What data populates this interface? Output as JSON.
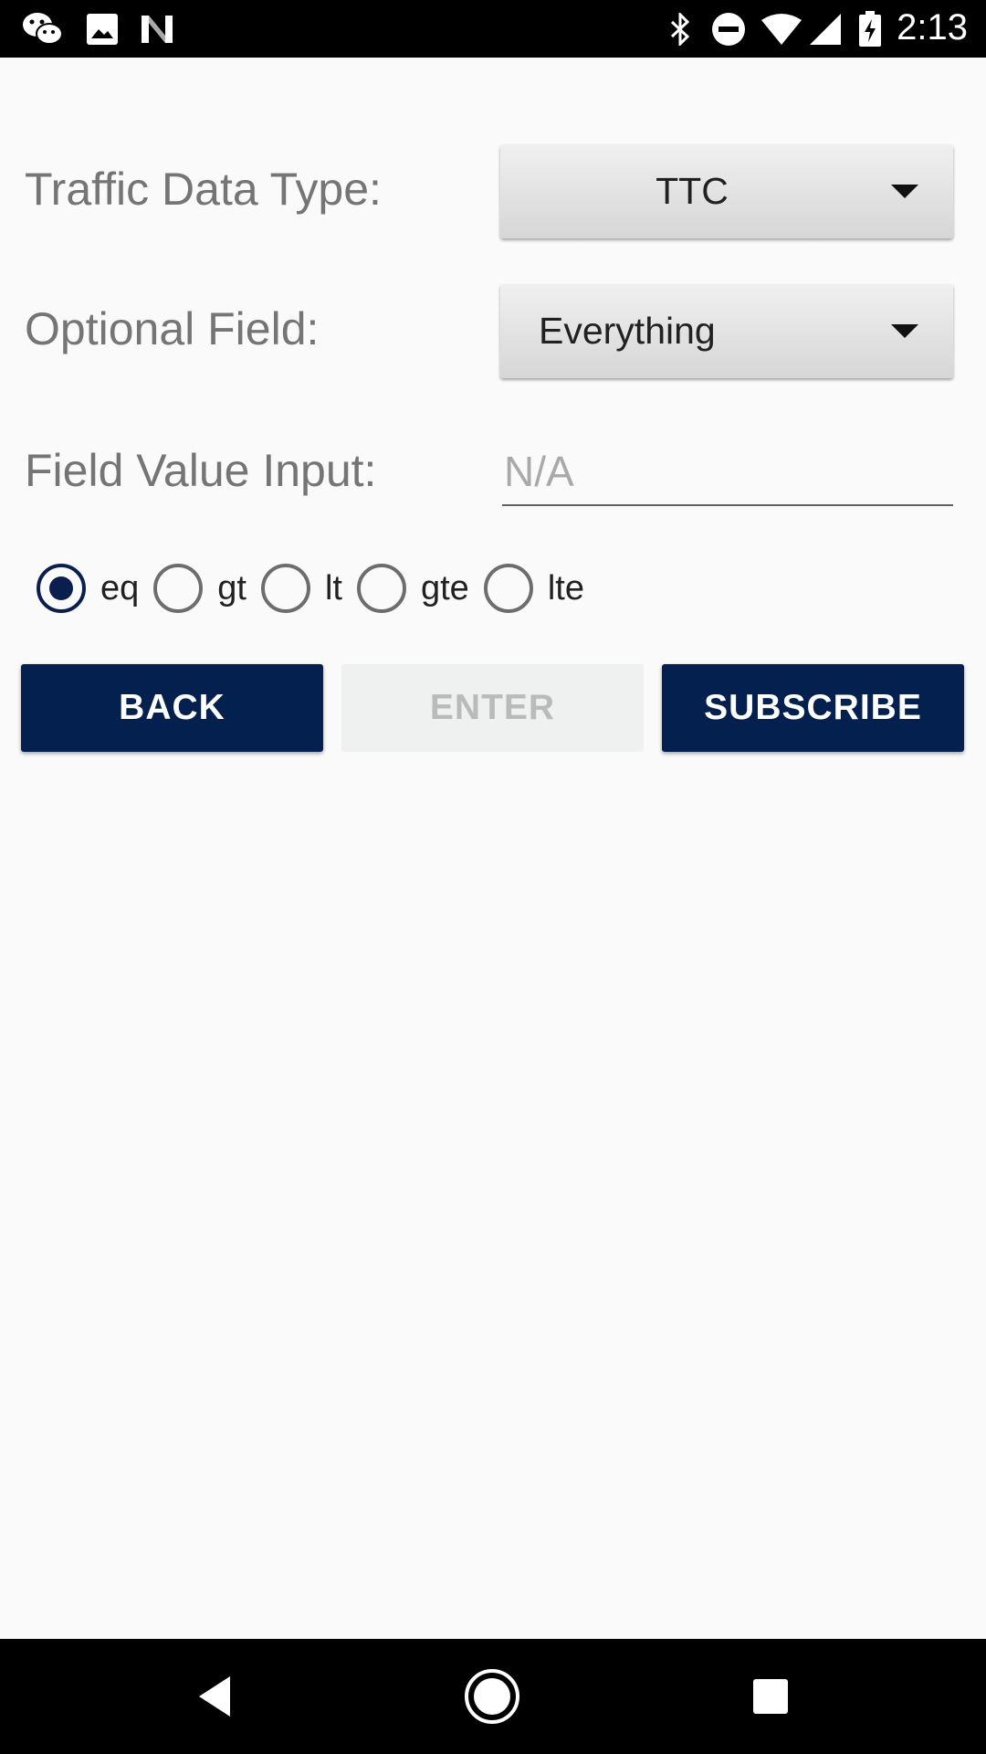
{
  "status_bar": {
    "left_icons": [
      "wechat-icon",
      "image-icon",
      "n-logo-icon"
    ],
    "right_icons": [
      "bluetooth-icon",
      "do-not-disturb-icon",
      "wifi-icon",
      "cellular-signal-icon",
      "battery-charging-icon"
    ],
    "time": "2:13"
  },
  "form": {
    "traffic_data_type": {
      "label": "Traffic Data Type:",
      "selected": "TTC"
    },
    "optional_field": {
      "label": "Optional Field:",
      "selected": "Everything"
    },
    "field_value": {
      "label": "Field Value Input:",
      "value": "",
      "placeholder": "N/A"
    },
    "operators": [
      {
        "label": "eq",
        "checked": true
      },
      {
        "label": "gt",
        "checked": false
      },
      {
        "label": "lt",
        "checked": false
      },
      {
        "label": "gte",
        "checked": false
      },
      {
        "label": "lte",
        "checked": false
      }
    ]
  },
  "buttons": {
    "back": "BACK",
    "enter": "ENTER",
    "subscribe": "SUBSCRIBE"
  },
  "nav_bar": {
    "icons": [
      "back-triangle-icon",
      "home-circle-icon",
      "recents-square-icon"
    ]
  },
  "colors": {
    "primary": "#03204f",
    "disabled_bg": "#eff0f0",
    "label_gray": "#757575",
    "background": "#fafafa"
  }
}
